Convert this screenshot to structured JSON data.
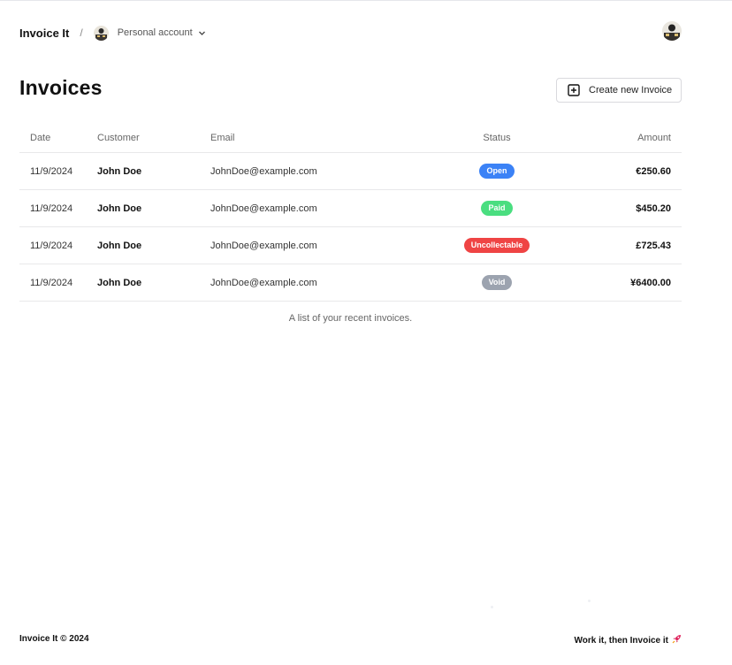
{
  "header": {
    "brand": "Invoice It",
    "separator": "/",
    "account_label": "Personal account",
    "account_icon": "user-avatar-icon",
    "chevron_icon": "chevron-down-icon"
  },
  "page": {
    "title": "Invoices",
    "create_button_label": "Create new Invoice",
    "create_button_icon": "plus-square-icon"
  },
  "table": {
    "columns": [
      "Date",
      "Customer",
      "Email",
      "Status",
      "Amount"
    ],
    "rows": [
      {
        "date": "11/9/2024",
        "customer": "John Doe",
        "email": "JohnDoe@example.com",
        "status": "Open",
        "amount": "€250.60"
      },
      {
        "date": "11/9/2024",
        "customer": "John Doe",
        "email": "JohnDoe@example.com",
        "status": "Paid",
        "amount": "$450.20"
      },
      {
        "date": "11/9/2024",
        "customer": "John Doe",
        "email": "JohnDoe@example.com",
        "status": "Uncollectable",
        "amount": "£725.43"
      },
      {
        "date": "11/9/2024",
        "customer": "John Doe",
        "email": "JohnDoe@example.com",
        "status": "Void",
        "amount": "¥6400.00"
      }
    ],
    "caption": "A list of your recent invoices."
  },
  "status_colors": {
    "Open": "#3b82f6",
    "Paid": "#4ade80",
    "Uncollectable": "#ef4444",
    "Void": "#9ca3af"
  },
  "footer": {
    "left": "Invoice It © 2024",
    "right": "Work it, then Invoice it",
    "right_icon": "rocket-icon"
  }
}
